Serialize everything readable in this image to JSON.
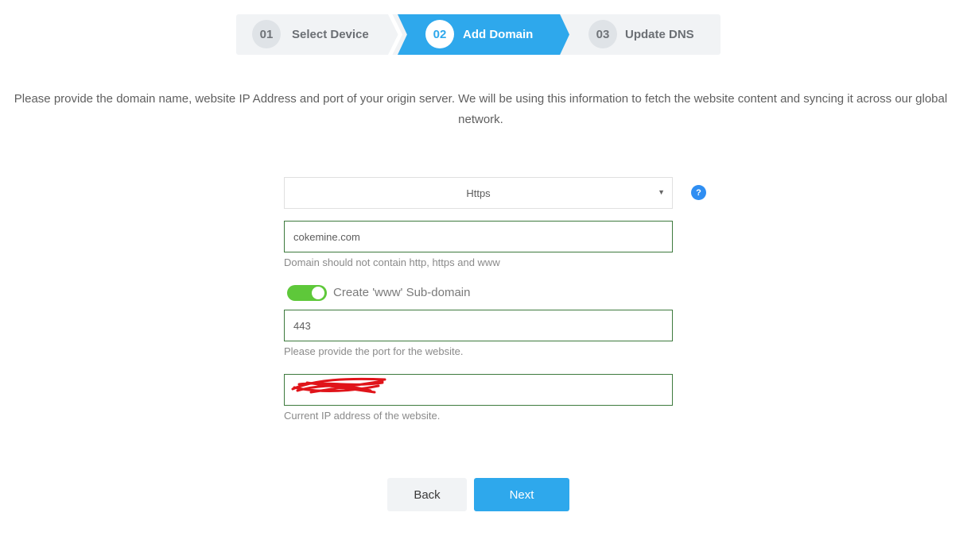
{
  "stepper": {
    "steps": [
      {
        "number": "01",
        "label": "Select Device",
        "state": "done"
      },
      {
        "number": "02",
        "label": "Add Domain",
        "state": "active"
      },
      {
        "number": "03",
        "label": "Update DNS",
        "state": "pending"
      }
    ]
  },
  "intro": {
    "text": "Please provide the domain name, website IP Address and port of your origin server. We will be using this information to fetch the website content and syncing it across our global network."
  },
  "form": {
    "protocol": {
      "selected": "Https",
      "help_icon": "question-icon"
    },
    "domain": {
      "value": "cokemine.com",
      "hint": "Domain should not contain http, https and www"
    },
    "www_subdomain": {
      "label": "Create 'www' Sub-domain",
      "enabled": true
    },
    "port": {
      "value": "443",
      "hint": "Please provide the port for the website."
    },
    "ip": {
      "hint": "Current IP address of the website."
    }
  },
  "actions": {
    "back_label": "Back",
    "next_label": "Next"
  },
  "colors": {
    "accent": "#2ea8ec",
    "toggle_on": "#5ec83a",
    "field_border": "#3d7a3d"
  }
}
